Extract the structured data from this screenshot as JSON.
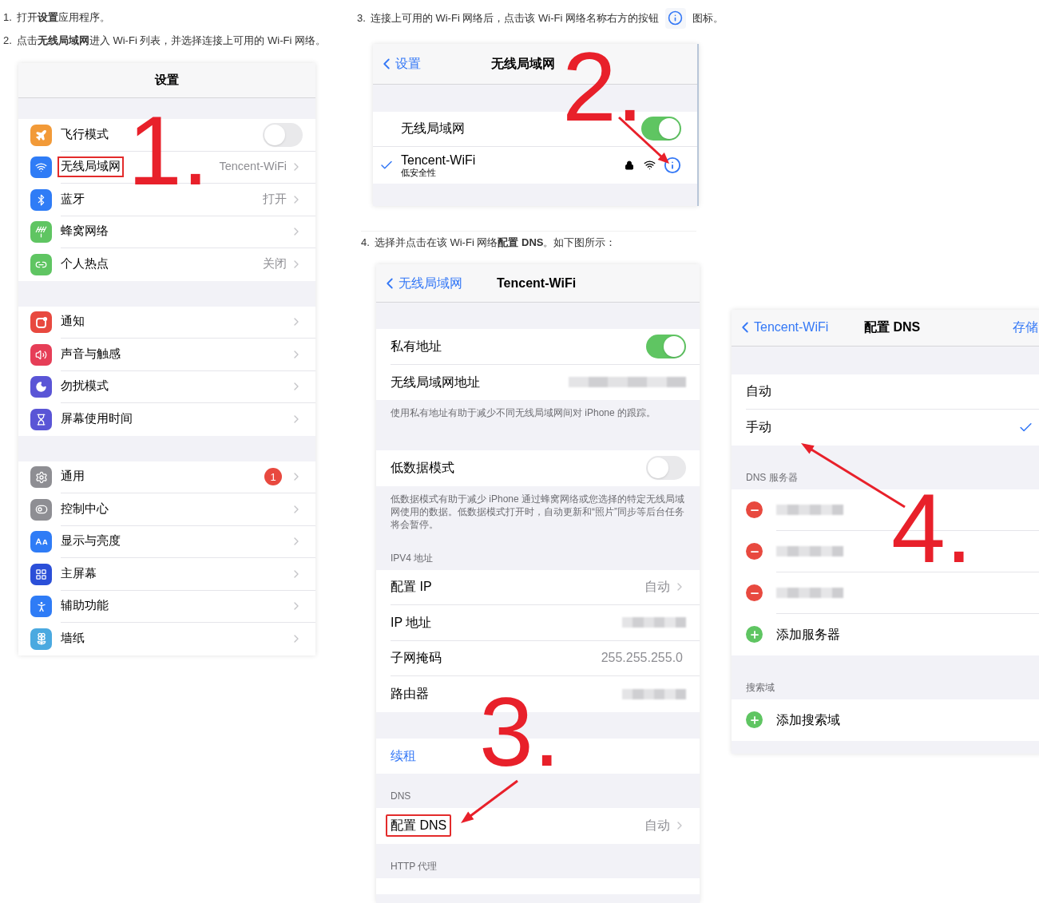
{
  "steps_left": [
    {
      "number": "1.",
      "text": "打开**设置**应用程序。"
    },
    {
      "number": "2.",
      "text": "点击**无线局域网**进入 Wi-Fi 列表，并选择连接上可用的 Wi-Fi 网络。"
    }
  ],
  "step3": {
    "number": "3.",
    "text_before": "连接上可用的 Wi-Fi 网络后，点击该 Wi-Fi 网络名称右方的按钮",
    "text_after": "图标。"
  },
  "step4": {
    "number": "4.",
    "text": "选择并点击在该 Wi-Fi 网络**配置 DNS**。如下图所示："
  },
  "settings_screen": {
    "title": "设置",
    "groups": [
      [
        {
          "label": "飞行模式",
          "color": "#f29a38",
          "kind": "toggle",
          "on": false,
          "highlighted": false
        },
        {
          "label": "无线局域网",
          "color": "#2f7cf6",
          "kind": "value",
          "value": "Tencent-WiFi",
          "highlighted": true
        },
        {
          "label": "蓝牙",
          "color": "#2f7cf6",
          "kind": "value",
          "value": "打开",
          "highlighted": false
        },
        {
          "label": "蜂窝网络",
          "color": "#5fc562",
          "kind": "value",
          "highlighted": false
        },
        {
          "label": "个人热点",
          "color": "#5fc562",
          "kind": "value",
          "value": "关闭",
          "highlighted": false
        }
      ],
      [
        {
          "label": "通知",
          "color": "#e8493f",
          "kind": "value",
          "highlighted": false
        },
        {
          "label": "声音与触感",
          "color": "#e63e57",
          "kind": "value",
          "highlighted": false
        },
        {
          "label": "勿扰模式",
          "color": "#5a55d6",
          "kind": "value",
          "highlighted": false
        },
        {
          "label": "屏幕使用时间",
          "color": "#5a55d6",
          "kind": "value",
          "highlighted": false
        }
      ],
      [
        {
          "label": "通用",
          "color": "#8e8e93",
          "kind": "value",
          "badge": "1",
          "highlighted": false
        },
        {
          "label": "控制中心",
          "color": "#8e8e93",
          "kind": "value",
          "highlighted": false
        },
        {
          "label": "显示与亮度",
          "color": "#2f7cf6",
          "kind": "value",
          "highlighted": false
        },
        {
          "label": "主屏幕",
          "color": "#2b4fd8",
          "kind": "value",
          "highlighted": false
        },
        {
          "label": "辅助功能",
          "color": "#2f7cf6",
          "kind": "value",
          "highlighted": false
        },
        {
          "label": "墙纸",
          "color": "#4aa9e0",
          "kind": "value",
          "highlighted": false
        }
      ]
    ]
  },
  "wifi_screen": {
    "back": "设置",
    "title": "无线局域网",
    "toggle": {
      "label": "无线局域网",
      "on": true
    },
    "networks": [
      {
        "name": "Tencent-WiFi",
        "subtitle": "低安全性",
        "selected": true
      }
    ]
  },
  "network_screen": {
    "back": "无线局域网",
    "title": "Tencent-WiFi",
    "sections": [
      {
        "rows": [
          {
            "kind": "toggle",
            "label": "私有地址",
            "on": true
          },
          {
            "kind": "blurred",
            "label": "无线局域网地址"
          }
        ],
        "footer": "使用私有地址有助于减少不同无线局域网间对 iPhone 的跟踪。"
      },
      {
        "rows": [
          {
            "kind": "toggle",
            "label": "低数据模式",
            "on": false
          }
        ],
        "footer": "低数据模式有助于减少 iPhone 通过蜂窝网络或您选择的特定无线局域网使用的数据。低数据模式打开时，自动更新和“照片”同步等后台任务将会暂停。"
      },
      {
        "header": "IPV4 地址",
        "rows": [
          {
            "kind": "value",
            "label": "配置 IP",
            "value": "自动",
            "chevron": true
          },
          {
            "kind": "blurred",
            "label": "IP 地址"
          },
          {
            "kind": "value",
            "label": "子网掩码",
            "value": "255.255.255.0",
            "chevron": false
          },
          {
            "kind": "blurred",
            "label": "路由器"
          }
        ]
      },
      {
        "rows": [
          {
            "kind": "link",
            "label": "续租"
          }
        ]
      },
      {
        "header": "DNS",
        "rows": [
          {
            "kind": "value",
            "label": "配置 DNS",
            "value": "自动",
            "chevron": true,
            "highlighted": true
          }
        ]
      },
      {
        "header": "HTTP 代理"
      }
    ]
  },
  "dns_screen": {
    "back": "Tencent-WiFi",
    "title": "配置 DNS",
    "action": "存储",
    "modes": [
      {
        "label": "自动",
        "selected": false
      },
      {
        "label": "手动",
        "selected": true
      }
    ],
    "servers_header": "DNS 服务器",
    "servers": [
      {
        "kind": "remove"
      },
      {
        "kind": "remove"
      },
      {
        "kind": "remove"
      },
      {
        "kind": "add",
        "label": "添加服务器"
      }
    ],
    "domains_header": "搜索域",
    "domains": [
      {
        "kind": "add",
        "label": "添加搜索域"
      }
    ]
  },
  "annotations": [
    {
      "label": "1."
    },
    {
      "label": "2."
    },
    {
      "label": "3."
    },
    {
      "label": "4."
    }
  ]
}
